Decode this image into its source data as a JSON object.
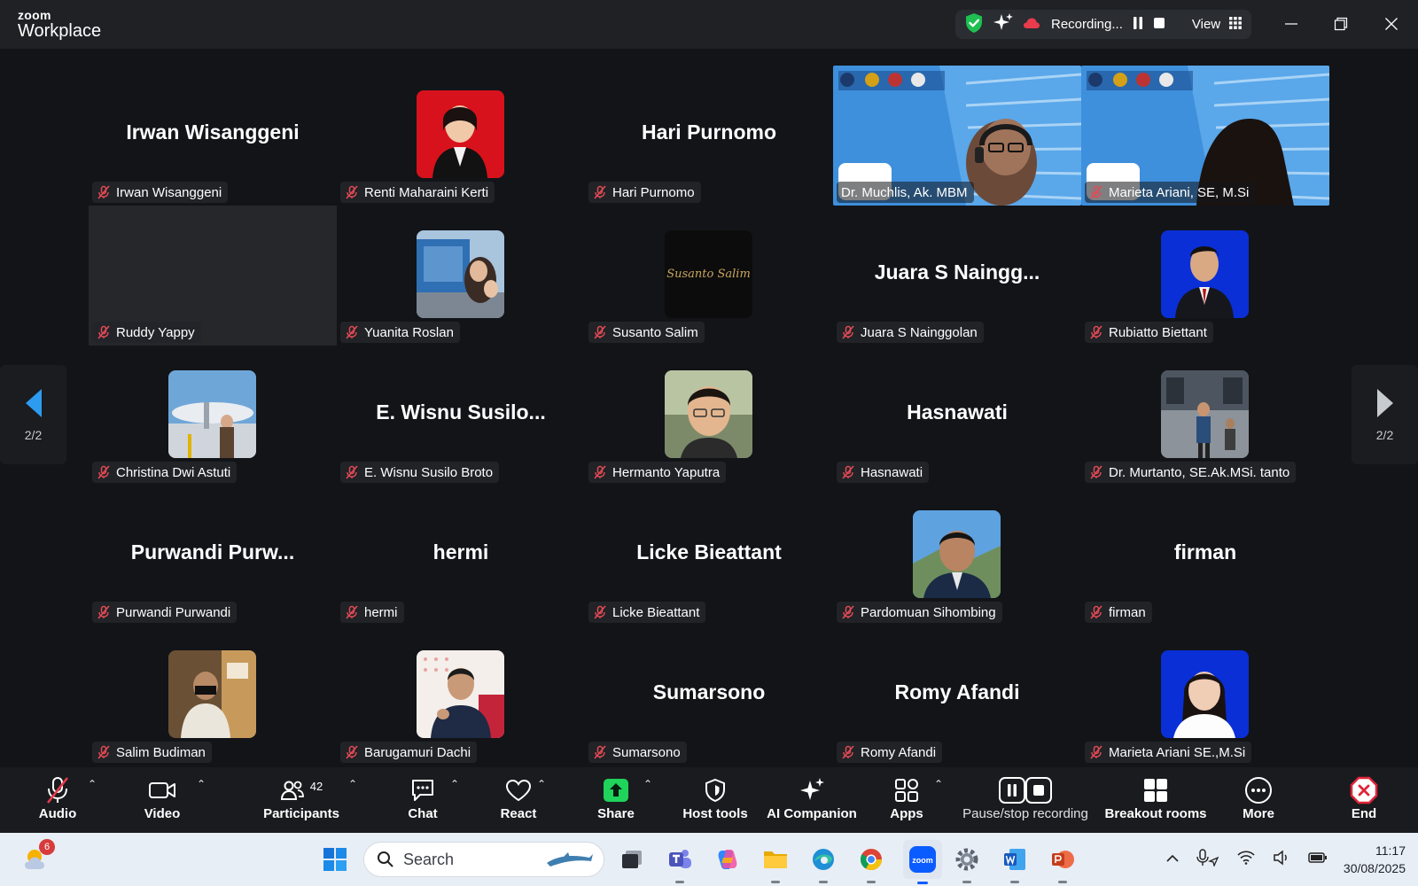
{
  "app": {
    "brand_small": "zoom",
    "brand_big": "Workplace"
  },
  "status": {
    "recording_text": "Recording...",
    "view_label": "View"
  },
  "gallery": {
    "page_left": "2/2",
    "page_right": "2/2",
    "tiles": [
      {
        "display": "Irwan Wisanggeni",
        "name": "Irwan Wisanggeni",
        "kind": "text"
      },
      {
        "name": "Renti Maharaini Kerti",
        "kind": "avatar",
        "avatar": "woman-red-bg"
      },
      {
        "display": "Hari Purnomo",
        "name": "Hari Purnomo",
        "kind": "text"
      },
      {
        "name": "Dr. Muchlis, Ak. MBM",
        "kind": "video"
      },
      {
        "name": "Marieta Ariani, SE, M.Si",
        "kind": "video"
      },
      {
        "name": "Ruddy Yappy",
        "kind": "grey"
      },
      {
        "name": "Yuanita Roslan",
        "kind": "avatar",
        "avatar": "photo-building"
      },
      {
        "name": "Susanto Salim",
        "kind": "avatar",
        "avatar": "script-logo",
        "avatar_text": "Susanto Salim"
      },
      {
        "display": "Juara S Naingg...",
        "name": "Juara S Nainggolan",
        "kind": "text"
      },
      {
        "name": "Rubiatto Biettant",
        "kind": "avatar",
        "avatar": "man-blue-bg"
      },
      {
        "name": "Christina Dwi Astuti",
        "kind": "avatar",
        "avatar": "photo-plane"
      },
      {
        "display": "E. Wisnu Susilo...",
        "name": "E. Wisnu Susilo Broto",
        "kind": "text"
      },
      {
        "name": "Hermanto Yaputra",
        "kind": "avatar",
        "avatar": "man-glasses"
      },
      {
        "display": "Hasnawati",
        "name": "Hasnawati",
        "kind": "text"
      },
      {
        "name": "Dr. Murtanto, SE.Ak.MSi. tanto",
        "kind": "avatar",
        "avatar": "photo-street"
      },
      {
        "display": "Purwandi Purw...",
        "name": "Purwandi Purwandi",
        "kind": "text"
      },
      {
        "display": "hermi",
        "name": "hermi",
        "kind": "text"
      },
      {
        "display": "Licke Bieattant",
        "name": "Licke Bieattant",
        "kind": "text"
      },
      {
        "name": "Pardomuan Sihombing",
        "kind": "avatar",
        "avatar": "man-outdoor"
      },
      {
        "display": "firman",
        "name": "firman",
        "kind": "text"
      },
      {
        "name": "Salim Budiman",
        "kind": "avatar",
        "avatar": "man-room"
      },
      {
        "name": "Barugamuri Dachi",
        "kind": "avatar",
        "avatar": "man-talking"
      },
      {
        "display": "Sumarsono",
        "name": "Sumarsono",
        "kind": "text"
      },
      {
        "display": "Romy Afandi",
        "name": "Romy Afandi",
        "kind": "text"
      },
      {
        "name": "Marieta Ariani SE.,M.Si",
        "kind": "avatar",
        "avatar": "woman-blue-bg"
      }
    ]
  },
  "toolbar": {
    "audio": "Audio",
    "video": "Video",
    "participants": "Participants",
    "participants_count": "42",
    "chat": "Chat",
    "react": "React",
    "share": "Share",
    "host_tools": "Host tools",
    "ai_companion": "AI Companion",
    "apps": "Apps",
    "pause_stop": "Pause/stop recording",
    "breakout": "Breakout rooms",
    "more": "More",
    "end": "End"
  },
  "taskbar": {
    "weather_badge": "6",
    "search_placeholder": "Search",
    "time": "11:17",
    "date": "30/08/2025"
  },
  "colors": {
    "accent_blue": "#1a73e8",
    "muted_red": "#e34a55",
    "share_green": "#1fd35b",
    "end_red": "#e0253a"
  }
}
